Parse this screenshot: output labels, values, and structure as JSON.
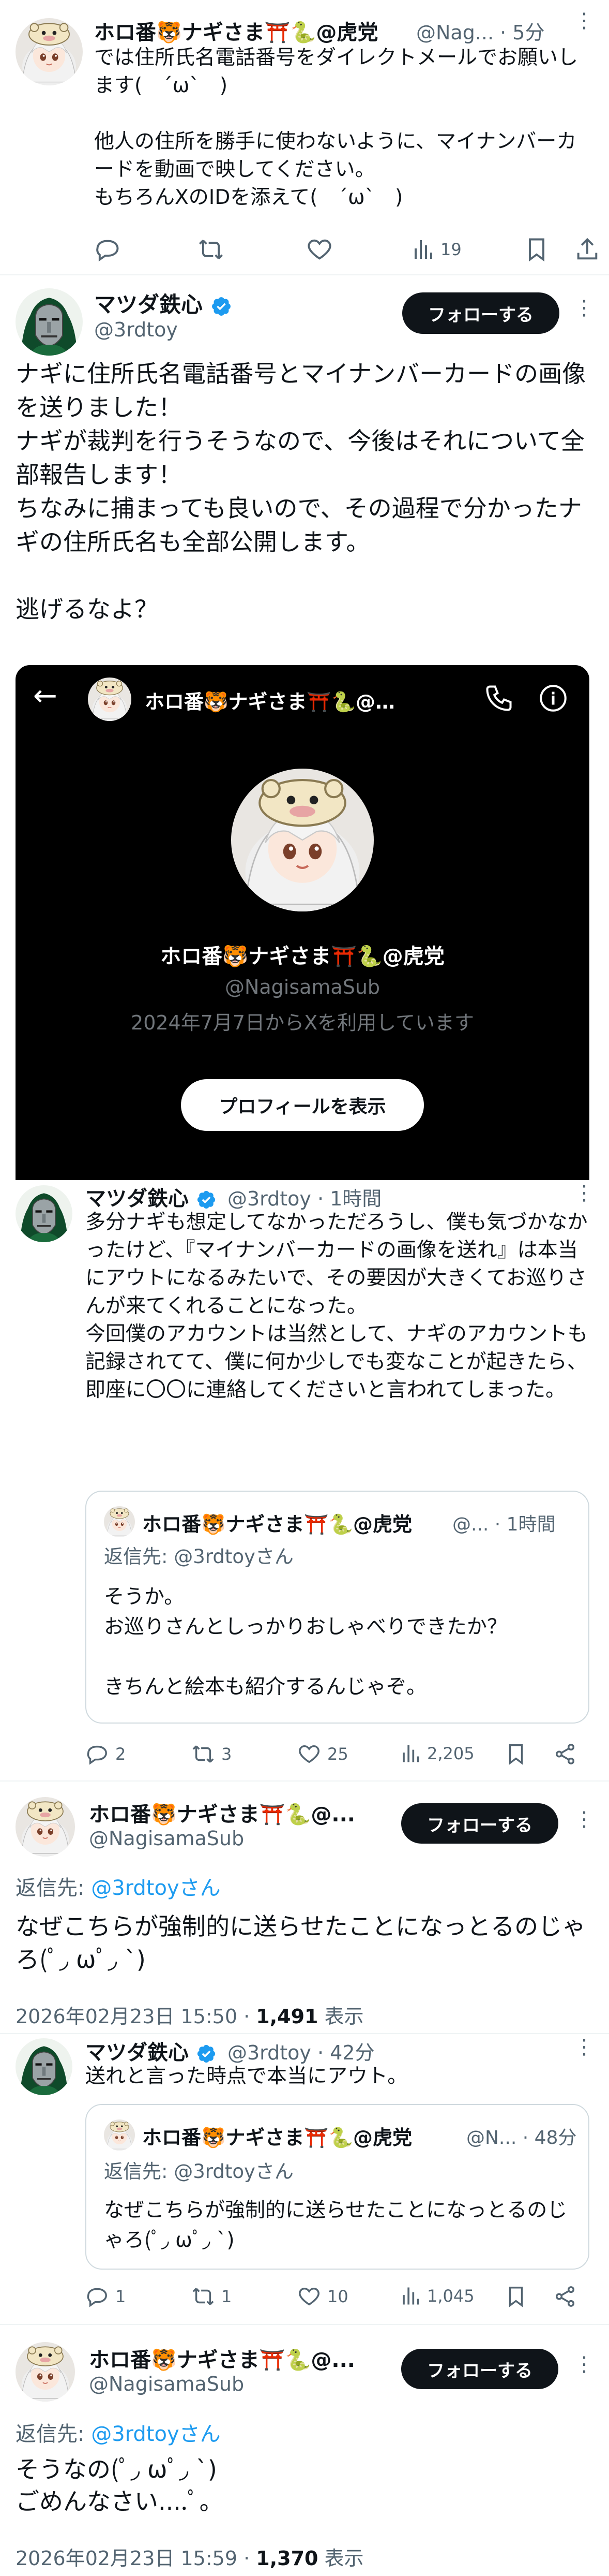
{
  "post1": {
    "name": "ホロ番🐯ナギさま⛩️🐍@虎党",
    "handle_time": "@Nag... · 5分",
    "text": "では住所氏名電話番号をダイレクトメールでお願いします(　´ω`　)\n\n他人の住所を勝手に使わないように、マイナンバーカードを動画で映してください。\nもちろんXのIDを添えて(　´ω`　)",
    "views": "19"
  },
  "post2": {
    "name": "マツダ鉄心",
    "handle": "@3rdtoy",
    "follow_label": "フォローする",
    "text": "ナギに住所氏名電話番号とマイナンバーカードの画像を送りました！\nナギが裁判を行うそうなので、今後はそれについて全部報告します！\nちなみに捕まっても良いので、その過程で分かったナギの住所氏名も全部公開します。\n\n逃げるなよ？",
    "dm_header_name": "ホロ番🐯ナギさま⛩️🐍@…",
    "dm_profile_name": "ホロ番🐯ナギさま⛩️🐍@虎党",
    "dm_profile_handle": "@NagisamaSub",
    "dm_profile_since": "2024年7月7日からXを利用しています",
    "dm_profile_button": "プロフィールを表示"
  },
  "post3": {
    "name": "マツダ鉄心",
    "handle_time": "@3rdtoy · 1時間",
    "text": "多分ナギも想定してなかっただろうし、僕も気づかなかったけど、『マイナンバーカードの画像を送れ』は本当にアウトになるみたいで、その要因が大きくてお巡りさんが来てくれることになった。\n今回僕のアカウントは当然として、ナギのアカウントも記録されてて、僕に何か少しでも変なことが起きたら、即座に〇〇に連絡してくださいと言われてしまった。",
    "quote_name": "ホロ番🐯ナギさま⛩️🐍@虎党",
    "quote_handle_time": "@... · 1時間",
    "quote_reply_prefix": "返信先: ",
    "quote_reply_to": "@3rdtoyさん",
    "quote_text": "そうか。\nお巡りさんとしっかりおしゃべりできたか？\n\nきちんと絵本も紹介するんじゃぞ。",
    "replies": "2",
    "reposts": "3",
    "likes": "25",
    "views": "2,205"
  },
  "post4": {
    "name": "ホロ番🐯ナギさま⛩️🐍@...",
    "handle": "@NagisamaSub",
    "follow_label": "フォローする",
    "reply_prefix": "返信先: ",
    "reply_to": "@3rdtoyさん",
    "text": "なぜこちらが強制的に送らせたことになっとるのじゃろ(ﾟ◞ ωﾟ◞ `)",
    "timestamp": "2026年02月23日 15:50 · ",
    "views_count": "1,491",
    "views_label": " 表示"
  },
  "post5": {
    "name": "マツダ鉄心",
    "handle_time": "@3rdtoy · 42分",
    "text": "送れと言った時点で本当にアウト。",
    "quote_name": "ホロ番🐯ナギさま⛩️🐍@虎党",
    "quote_handle_time": "@N... · 48分",
    "quote_reply_prefix": "返信先: ",
    "quote_reply_to": "@3rdtoyさん",
    "quote_text": "なぜこちらが強制的に送らせたことになっとるのじゃろ(ﾟ◞ ωﾟ◞ `)",
    "replies": "1",
    "reposts": "1",
    "likes": "10",
    "views": "1,045"
  },
  "post6": {
    "name": "ホロ番🐯ナギさま⛩️🐍@...",
    "handle": "@NagisamaSub",
    "follow_label": "フォローする",
    "reply_prefix": "返信先: ",
    "reply_to": "@3rdtoyさん",
    "text": "そうなの(ﾟ◞ ωﾟ◞ `)\nごめんなさい....ﾟ。",
    "timestamp": "2026年02月23日 15:59 · ",
    "views_count": "1,370",
    "views_label": " 表示"
  },
  "colors": {
    "accent": "#1d9bf0",
    "text": "#0f1419",
    "muted": "#536471",
    "dm_bg": "#000000"
  }
}
